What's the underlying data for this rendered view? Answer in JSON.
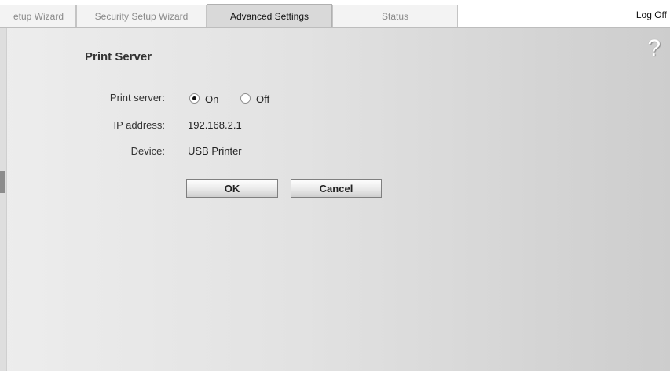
{
  "tabs": [
    {
      "label": "etup Wizard",
      "active": false
    },
    {
      "label": "Security Setup Wizard",
      "active": false
    },
    {
      "label": "Advanced Settings",
      "active": true
    },
    {
      "label": "Status",
      "active": false
    }
  ],
  "header": {
    "logoff_label": "Log Off",
    "help_glyph": "?"
  },
  "page": {
    "title": "Print Server"
  },
  "form": {
    "print_server_label": "Print server:",
    "print_server_options": [
      {
        "label": "On",
        "selected": true
      },
      {
        "label": "Off",
        "selected": false
      }
    ],
    "ip_label": "IP address:",
    "ip_value": "192.168.2.1",
    "device_label": "Device:",
    "device_value": "USB Printer"
  },
  "buttons": {
    "ok_label": "OK",
    "cancel_label": "Cancel"
  },
  "colors": {
    "panel": "#e2e2e2",
    "active_tab": "#d9d9d9"
  }
}
